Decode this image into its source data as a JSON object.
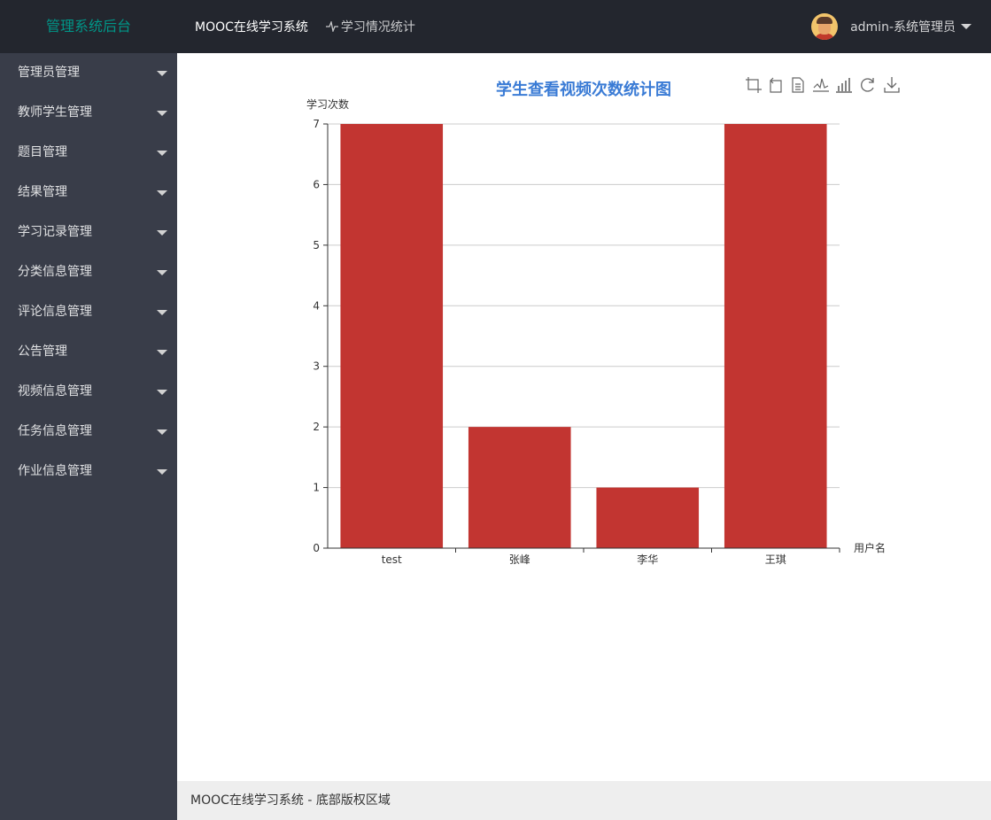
{
  "header": {
    "logo": "管理系统后台",
    "nav": [
      "MOOC在线学习系统",
      "学习情况统计"
    ],
    "user_label": "admin-系统管理员"
  },
  "sidebar": {
    "items": [
      "管理员管理",
      "教师学生管理",
      "题目管理",
      "结果管理",
      "学习记录管理",
      "分类信息管理",
      "评论信息管理",
      "公告管理",
      "视频信息管理",
      "任务信息管理",
      "作业信息管理"
    ]
  },
  "footer": {
    "text": "MOOC在线学习系统 - 底部版权区域"
  },
  "colors": {
    "bar": "#c23531",
    "title": "#3a7bd5",
    "logo": "#009688"
  },
  "toolbox": [
    "data-zoom-icon",
    "zoom-reset-icon",
    "data-view-icon",
    "line-chart-icon",
    "bar-chart-icon",
    "restore-icon",
    "save-image-icon"
  ],
  "chart_data": {
    "type": "bar",
    "title": "学生查看视频次数统计图",
    "xlabel": "用户名",
    "ylabel": "学习次数",
    "categories": [
      "test",
      "张峰",
      "李华",
      "王琪"
    ],
    "values": [
      7,
      2,
      1,
      7
    ],
    "ylim": [
      0,
      7
    ],
    "yticks": [
      0,
      1,
      2,
      3,
      4,
      5,
      6,
      7
    ],
    "grid": true
  }
}
